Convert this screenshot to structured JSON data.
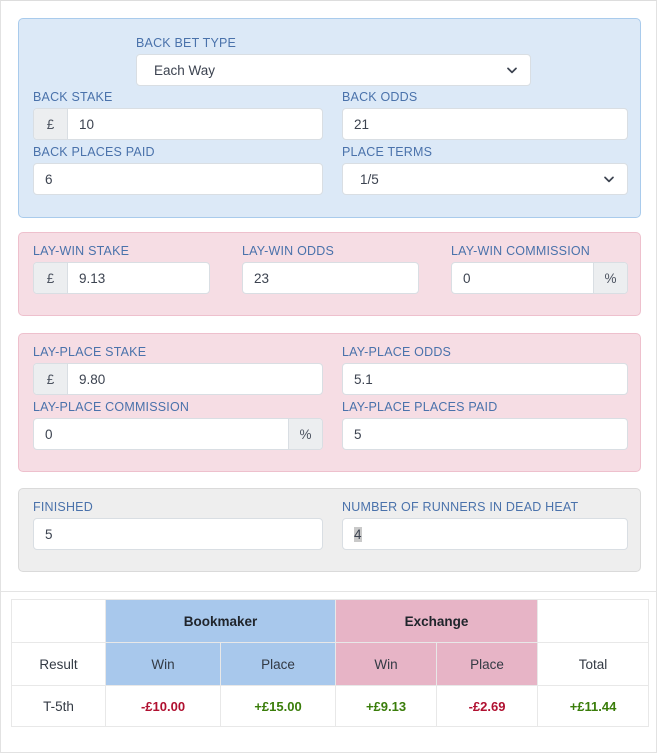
{
  "sections": {
    "back": {
      "bet_type": {
        "label": "BACK BET TYPE",
        "value": "Each Way",
        "icon": "chevron-down-icon"
      },
      "stake": {
        "label": "BACK STAKE",
        "prefix": "£",
        "value": "10"
      },
      "odds": {
        "label": "BACK ODDS",
        "value": "21"
      },
      "places_paid": {
        "label": "BACK PLACES PAID",
        "value": "6"
      },
      "place_terms": {
        "label": "PLACE TERMS",
        "value": "1/5",
        "icon": "chevron-down-icon"
      }
    },
    "lay_win": {
      "stake": {
        "label": "LAY-WIN STAKE",
        "prefix": "£",
        "value": "9.13"
      },
      "odds": {
        "label": "LAY-WIN ODDS",
        "value": "23"
      },
      "commission": {
        "label": "LAY-WIN COMMISSION",
        "value": "0",
        "suffix": "%"
      }
    },
    "lay_place": {
      "stake": {
        "label": "LAY-PLACE STAKE",
        "prefix": "£",
        "value": "9.80"
      },
      "odds": {
        "label": "LAY-PLACE ODDS",
        "value": "5.1"
      },
      "commission": {
        "label": "LAY-PLACE COMMISSION",
        "value": "0",
        "suffix": "%"
      },
      "places_paid": {
        "label": "LAY-PLACE PLACES PAID",
        "value": "5"
      }
    },
    "outcome": {
      "finished": {
        "label": "FINISHED",
        "value": "5"
      },
      "dead_heat": {
        "label": "NUMBER OF RUNNERS IN DEAD HEAT",
        "value": "4"
      }
    }
  },
  "results_table": {
    "group_headers": {
      "blank_left": "",
      "bookmaker": "Bookmaker",
      "exchange": "Exchange",
      "blank_right": ""
    },
    "column_headers": {
      "result": "Result",
      "bookmaker_win": "Win",
      "bookmaker_place": "Place",
      "exchange_win": "Win",
      "exchange_place": "Place",
      "total": "Total"
    },
    "rows": [
      {
        "result": "T-5th",
        "bookmaker_win": "-£10.00",
        "bookmaker_win_sign": "neg",
        "bookmaker_place": "+£15.00",
        "bookmaker_place_sign": "pos",
        "exchange_win": "+£9.13",
        "exchange_win_sign": "pos",
        "exchange_place": "-£2.69",
        "exchange_place_sign": "neg",
        "total": "+£11.44",
        "total_sign": "pos"
      }
    ]
  },
  "colors": {
    "back_bg": "#dce9f7",
    "back_border": "#a9cbec",
    "lay_bg": "#f6dde4",
    "lay_border": "#eec0cd",
    "neutral_bg": "#eeeeee",
    "bookmaker_col": "#a8c8ec",
    "exchange_col": "#e7b4c6",
    "positive": "#3a7d0a",
    "negative": "#b01030",
    "label_blue": "#4a72ab"
  }
}
